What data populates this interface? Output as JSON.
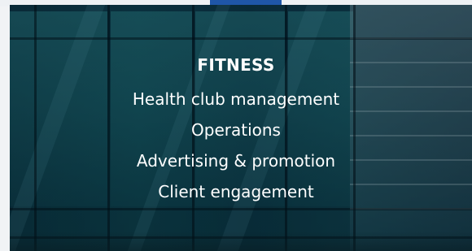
{
  "hero": {
    "title": "FITNESS",
    "items": [
      "Health club management",
      "Operations",
      "Advertising & promotion",
      "Client engagement"
    ]
  },
  "colors": {
    "accent": "#1f56a8",
    "text": "#ffffff"
  }
}
